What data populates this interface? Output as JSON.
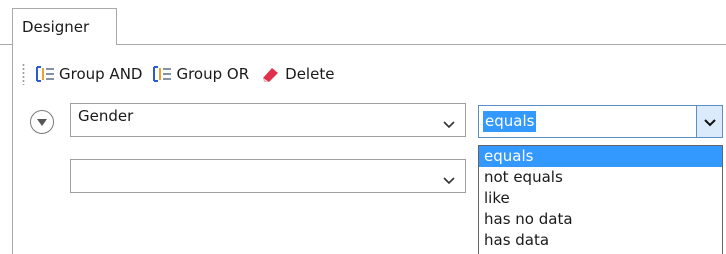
{
  "tabs": [
    {
      "label": "Designer",
      "active": true
    }
  ],
  "toolbar": {
    "group_and": "Group AND",
    "group_or": "Group OR",
    "delete": "Delete"
  },
  "condition": {
    "field_value": "Gender",
    "operator_value": "equals",
    "value_value": ""
  },
  "operator_options": [
    "equals",
    "not equals",
    "like",
    "has no data",
    "has data"
  ],
  "colors": {
    "selection": "#3399ff",
    "border": "#a9a9a9",
    "focus_border": "#5a8fc9",
    "group_icon": "#2a5bd7",
    "delete_icon": "#e0304a"
  }
}
